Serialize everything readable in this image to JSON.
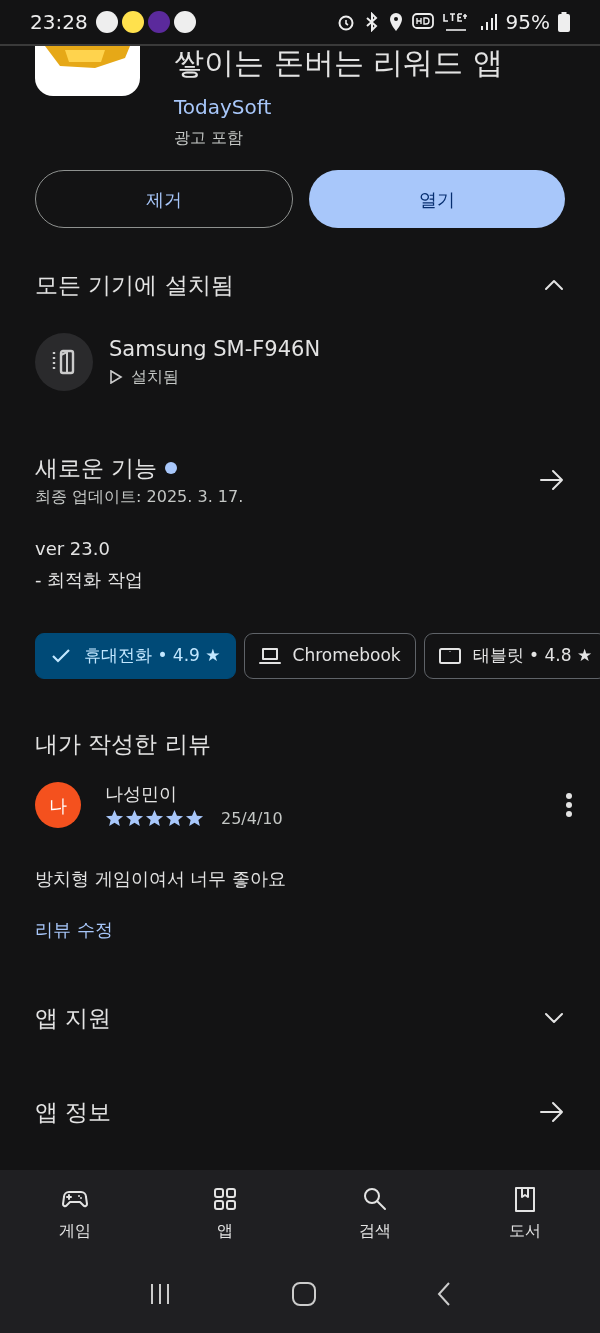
{
  "status_bar": {
    "time": "23:28",
    "battery": "95%"
  },
  "app": {
    "title": "쌓이는 돈버는 리워드 앱",
    "developer": "TodaySoft",
    "note": "광고 포함"
  },
  "actions": [
    {
      "label": "제거",
      "kind": "outline"
    },
    {
      "label": "열기",
      "kind": "filled"
    }
  ],
  "installed_section": {
    "title": "모든 기기에 설치됨",
    "expanded": true,
    "device": {
      "name": "Samsung SM-F946N",
      "status": "설치됨"
    }
  },
  "whats_new": {
    "title": "새로운 기능",
    "unread": true,
    "updated": "최종 업데이트: 2025. 3. 17.",
    "lines": [
      "ver 23.0",
      "- 최적화 작업"
    ]
  },
  "device_chips": [
    {
      "label": "휴대전화 • 4.9 ★",
      "selected": true
    },
    {
      "label": "Chromebook",
      "kind": "laptop",
      "selected": false
    },
    {
      "label": "태블릿 • 4.8 ★",
      "kind": "tablet",
      "selected": false
    }
  ],
  "my_review": {
    "title": "내가 작성한 리뷰",
    "avatar": "나",
    "author": "나성민이",
    "stars": 5,
    "date": "25/4/10",
    "text": "방치형 게임이여서 너무 좋아요",
    "edit_link": "리뷰 수정"
  },
  "sections": [
    {
      "title": "앱 지원",
      "kind": "expand",
      "expanded": false
    },
    {
      "title": "앱 정보",
      "kind": "link"
    }
  ],
  "bottom_nav": [
    {
      "label": "게임",
      "kind": "games"
    },
    {
      "label": "앱",
      "kind": "apps"
    },
    {
      "label": "검색",
      "kind": "search"
    },
    {
      "label": "도서",
      "kind": "books"
    }
  ]
}
